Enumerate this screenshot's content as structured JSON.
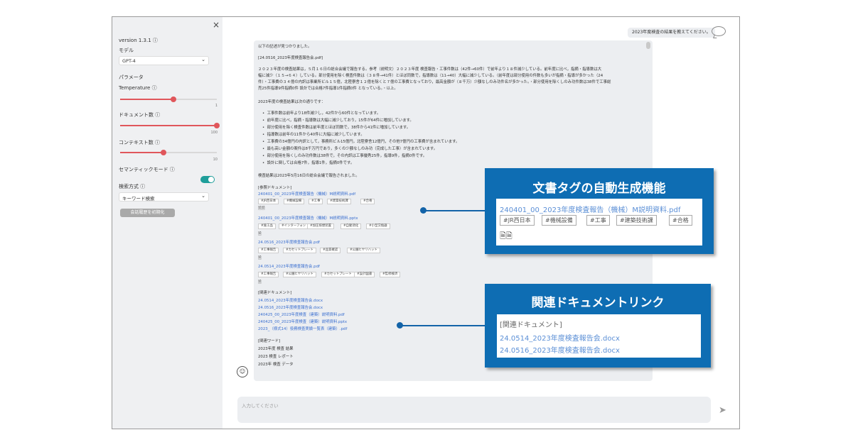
{
  "sidebar": {
    "close": "×",
    "version": "version 1.3.1 ⓘ",
    "model_label": "モデル",
    "model_value": "GPT-4",
    "params_label": "パラメータ",
    "temperature_label": "Temperature ⓘ",
    "temperature_max": "1",
    "temperature_level": 0.55,
    "documents_label": "ドキュメント数 ⓘ",
    "documents_max": "100",
    "documents_level": 1.0,
    "context_label": "コンテキスト数 ⓘ",
    "context_max": "10",
    "context_level": 0.45,
    "semantic_label": "セマンティックモード ⓘ",
    "search_label": "検索方式 ⓘ",
    "search_value": "キーワード検索",
    "reset_button": "会話履歴を初期化"
  },
  "chat": {
    "user_question": "2023年度検査の結果を教えてください。",
    "answer_intro": "以下の記述が見つかりました。",
    "source_file": "[24.0516_2023年度検査報告会.pdf]",
    "para1_l1": "２０２３年度の検査結果は，５月１６日の総合会議で報告する。参考（説明文）２０２３年度 検査報告・工事件数は（42件→60件）で前年より１８件減少している。前年度に比べ，指摘・指導数は大",
    "para1_l2": "幅に減少（１５→６４）している。部分使用を除く検査件数は（３８件→41件）とほぼ同数で，指導数は（11→40）大幅に減少している。（前年度は部分使用の件数も多いが指摘・指導が多かった（24",
    "para1_l3": "件）・工事費の３４億の内訳は事業所ビル１５億，北陸寮舎１２億を除くと７億の工事費となっており，最高金額が（８千万）少額なしのみ功件名が多かった。・部分使用を除くしのみ功件数は38件で工事総",
    "para1_l4": "売25件指導9件指摘0件 設計では合格7件指導1件指摘0件 となっている。・以上。",
    "summary_heading": "2023年度の検査結果は次の通りです：",
    "bullets": [
      "工事件数は前年より18件減少し，42件から60件となっています。",
      "前年度に比べ，指摘・指導数は大幅に減少しており，15件が64件に増加しています。",
      "部分使用を除く検査件数は前年度とほぼ同数で，38件から41件に増加しています。",
      "指導数は前年の11件から40件に大幅に減少しています。",
      "工事費の34億円の内訳として，事務所ビル15億円，北陸寮舎12億円，その他7億円の工事費が含まれています。",
      "最も高い金額の案件は8千万円であり，多くの少額なしのみ功（完成した工事）が含まれています。",
      "部分使用を除くしのみ功件数は38件で，その内訳は工事優秀25件，指導9件，指摘0件です。",
      "設計に関しては合格7件，指導1件，指摘0件です。"
    ],
    "report_note": "検査結果は2023年5月16日の総合会議で報告されました。",
    "ref_heading": "[参照ドキュメント]",
    "refs": [
      {
        "link": "240401_00_2023年度検査報告（機械）M説明資料.pdf",
        "tags": [
          "#JR西日本",
          "#機械設備",
          "#工事",
          "#建築技術課",
          "#合格"
        ]
      },
      {
        "link": "240401_00_2023年度検査報告（機械）M説明資料.pptx",
        "tags": [
          "#施工品",
          "#インターフォン",
          "#加圧排煙装置",
          "#自動消化",
          "#小型交換器"
        ]
      },
      {
        "link": "24.0516_2023年度検査報告会.pdf",
        "tags": [
          "#工事報告",
          "#カセットプレート",
          "#品質確認",
          "#公園ヒヤリハット"
        ]
      },
      {
        "link": "24.0514_2023年度検査報告会.pdf",
        "tags": [
          "#工事報告",
          "#公園ヒヤリハット",
          "#カセットプレート",
          "#設計図書",
          "#監修検済"
        ]
      }
    ],
    "related_heading": "[関連ドキュメント]",
    "related": [
      "24.0514_2023年度検査報告会.docx",
      "24.0516_2023年度検査報告会.docx",
      "240425_00_2023年度検査（建築）説明資料.pdf",
      "240425_00_2023年度検査（建築）説明資料.pptx",
      "2023_（様式14）役務検査実績一覧表（建築）.pdf"
    ],
    "words_heading": "[関連ワード]",
    "words": [
      "2023年度 検査 結果",
      "2023 検査 レポート",
      "2023年 検査 データ"
    ],
    "input_placeholder": "入力してください"
  },
  "callouts": {
    "tag_title": "文書タグの自動生成機能",
    "tag_link": "240401_00_2023年度検査報告（機械）M説明資料.pdf",
    "tag_tags": [
      "#JR西日本",
      "#機械設備",
      "#工事",
      "#建築技術課",
      "#合格"
    ],
    "related_title": "関連ドキュメントリンク",
    "related_heading": "[関連ドキュメント]",
    "related_links": [
      "24.0514_2023年度検査報告会.docx",
      "24.0516_2023年度検査報告会.docx"
    ]
  },
  "colors": {
    "callout_blue": "#0e6db3",
    "link": "#3a6fd0",
    "slider_red": "#e0565b",
    "toggle_teal": "#1f9e9a"
  }
}
